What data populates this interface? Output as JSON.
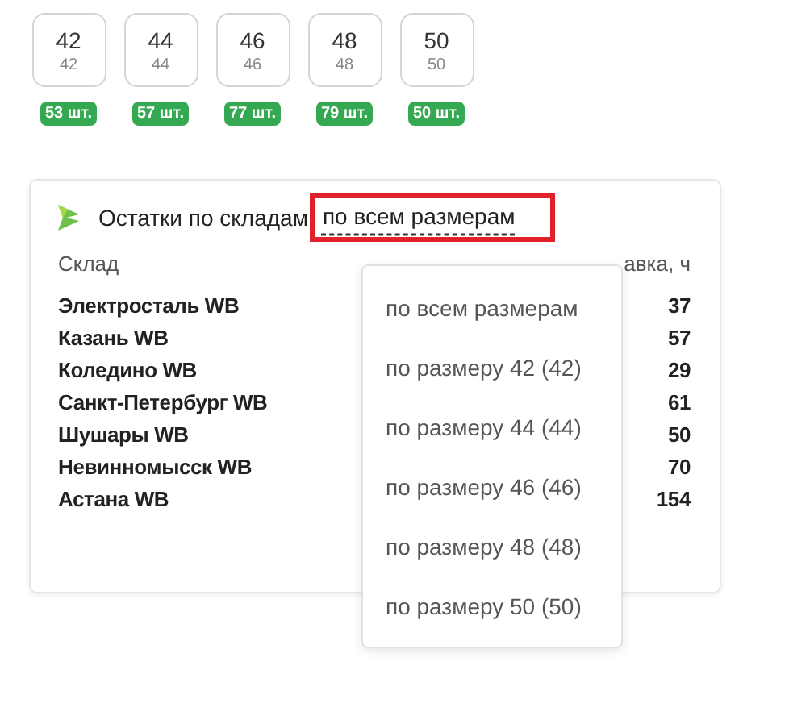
{
  "sizes": [
    {
      "size": "42",
      "sub": "42",
      "stock": "53 шт."
    },
    {
      "size": "44",
      "sub": "44",
      "stock": "57 шт."
    },
    {
      "size": "46",
      "sub": "46",
      "stock": "77 шт."
    },
    {
      "size": "48",
      "sub": "48",
      "stock": "79 шт."
    },
    {
      "size": "50",
      "sub": "50",
      "stock": "50 шт."
    }
  ],
  "card": {
    "title": "Остатки по складам",
    "selector": {
      "label": "по всем размерам",
      "open": true
    },
    "columns": [
      "Склад",
      "авка, ч"
    ],
    "rows": [
      {
        "warehouse": "Электросталь WB",
        "value": "37"
      },
      {
        "warehouse": "Казань WB",
        "value": "57"
      },
      {
        "warehouse": "Коледино WB",
        "value": "29"
      },
      {
        "warehouse": "Санкт-Петербург WB",
        "value": "61"
      },
      {
        "warehouse": "Шушары WB",
        "value": "50"
      },
      {
        "warehouse": "Невинномысск WB",
        "value": "70"
      },
      {
        "warehouse": "Астана WB",
        "value": "154"
      }
    ],
    "dropdown": [
      "по всем размерам",
      "по размеру 42 (42)",
      "по размеру 44 (44)",
      "по размеру 46 (46)",
      "по размеру 48 (48)",
      "по размеру 50 (50)"
    ]
  }
}
